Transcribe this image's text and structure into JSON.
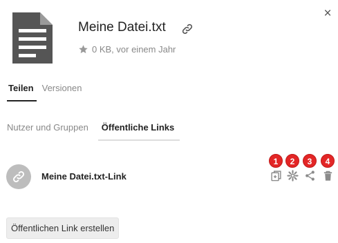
{
  "file": {
    "name": "Meine Datei.txt",
    "size_and_date": "0 KB, vor einem Jahr",
    "icon": "text-file-icon"
  },
  "main_tabs": [
    {
      "label": "Teilen",
      "active": true
    },
    {
      "label": "Versionen",
      "active": false
    }
  ],
  "sub_tabs": [
    {
      "label": "Nutzer und Gruppen",
      "active": false
    },
    {
      "label": "Öffentliche Links",
      "active": true
    }
  ],
  "public_link": {
    "name": "Meine Datei.txt-Link",
    "actions": [
      {
        "badge": "1",
        "icon": "copy-link-icon"
      },
      {
        "badge": "2",
        "icon": "settings-gear-icon"
      },
      {
        "badge": "3",
        "icon": "share-icon"
      },
      {
        "badge": "4",
        "icon": "trash-icon"
      }
    ]
  },
  "create_link_label": "Öffentlichen Link erstellen",
  "close_symbol": "×",
  "colors": {
    "badge": "#e32626",
    "icon_gray": "#8a8a8a",
    "file_icon": "#555555",
    "button_bg": "#ededed"
  }
}
